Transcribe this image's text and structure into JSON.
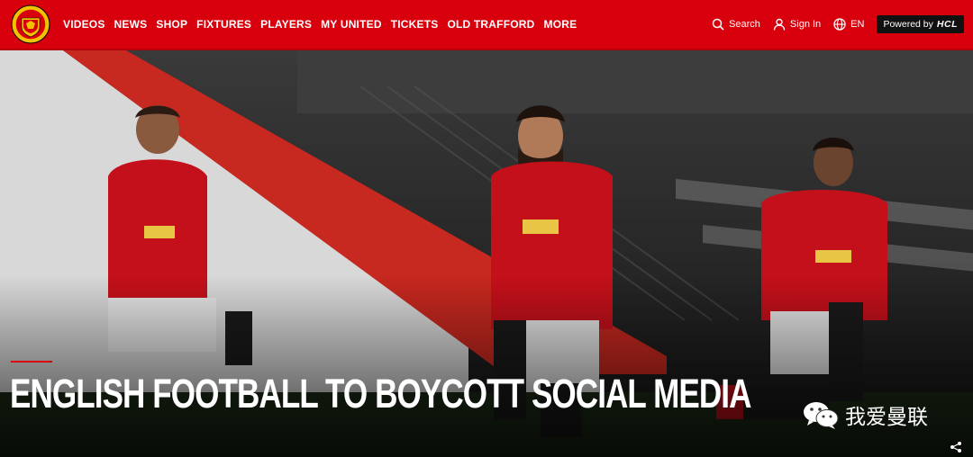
{
  "brand": {
    "name": "Manchester United"
  },
  "nav": {
    "items": [
      "VIDEOS",
      "NEWS",
      "SHOP",
      "FIXTURES",
      "PLAYERS",
      "MY UNITED",
      "TICKETS",
      "OLD TRAFFORD",
      "MORE"
    ]
  },
  "tools": {
    "search_label": "Search",
    "signin_label": "Sign In",
    "language_label": "EN",
    "powered_label": "Powered by",
    "powered_brand": "HCL"
  },
  "hero": {
    "headline": "ENGLISH FOOTBALL TO BOYCOTT SOCIAL MEDIA",
    "watermark": "我爱曼联"
  },
  "colors": {
    "brand_red": "#d9000d",
    "black": "#111111"
  }
}
